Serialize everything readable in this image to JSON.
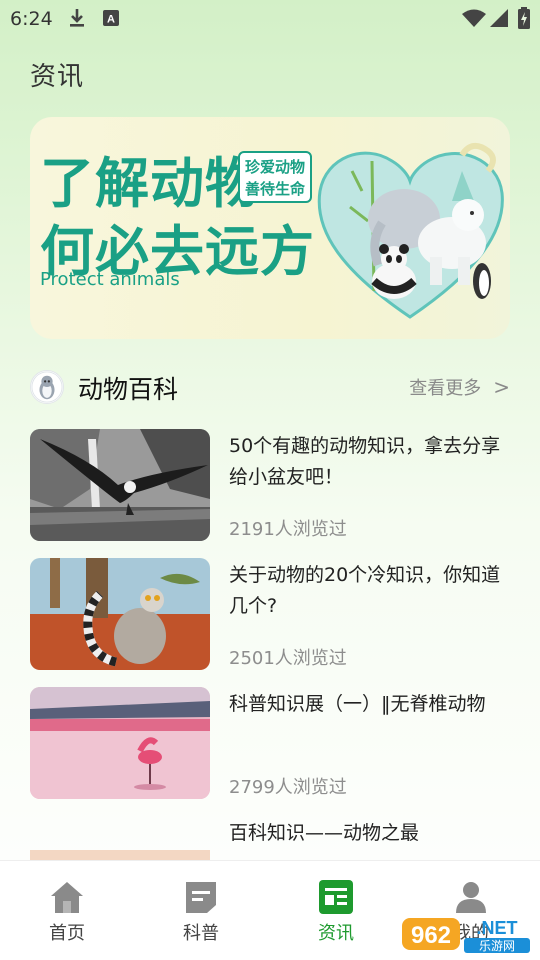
{
  "status_bar": {
    "time": "6:24",
    "icons": [
      "download-icon",
      "app-a-icon",
      "wifi-icon",
      "signal-icon",
      "battery-charging-icon"
    ]
  },
  "page": {
    "title": "资讯"
  },
  "banner": {
    "line1": "了解动物",
    "line2": "何必去远方",
    "badge_line1": "珍爱动物",
    "badge_line2": "善待生命",
    "subtitle": "Protect animals",
    "accent_color": "#1aa085"
  },
  "section": {
    "title": "动物百科",
    "more_label": "查看更多",
    "more_icon": "chevron-right-icon"
  },
  "articles": [
    {
      "title": "50个有趣的动物知识，拿去分享给小盆友吧！",
      "views": "2191人浏览过",
      "image": "eagle-over-water"
    },
    {
      "title": "关于动物的20个冷知识，你知道几个?",
      "views": "2501人浏览过",
      "image": "ring-tailed-lemur"
    },
    {
      "title": "科普知识展（一）‖无脊椎动物",
      "views": "2799人浏览过",
      "image": "flamingos-lake"
    },
    {
      "title": "百科知识——动物之最",
      "views": "",
      "image": "snow-mountain"
    }
  ],
  "bottom_nav": [
    {
      "label": "首页",
      "icon": "home-icon",
      "active": false
    },
    {
      "label": "科普",
      "icon": "document-icon",
      "active": false
    },
    {
      "label": "资讯",
      "icon": "news-icon",
      "active": true
    },
    {
      "label": "我的",
      "icon": "profile-icon",
      "active": false
    }
  ],
  "watermark": {
    "text": "962.NET",
    "subtext": "乐游网"
  },
  "colors": {
    "active_tab": "#1e9a2e",
    "muted_text": "#8d8d8d"
  }
}
